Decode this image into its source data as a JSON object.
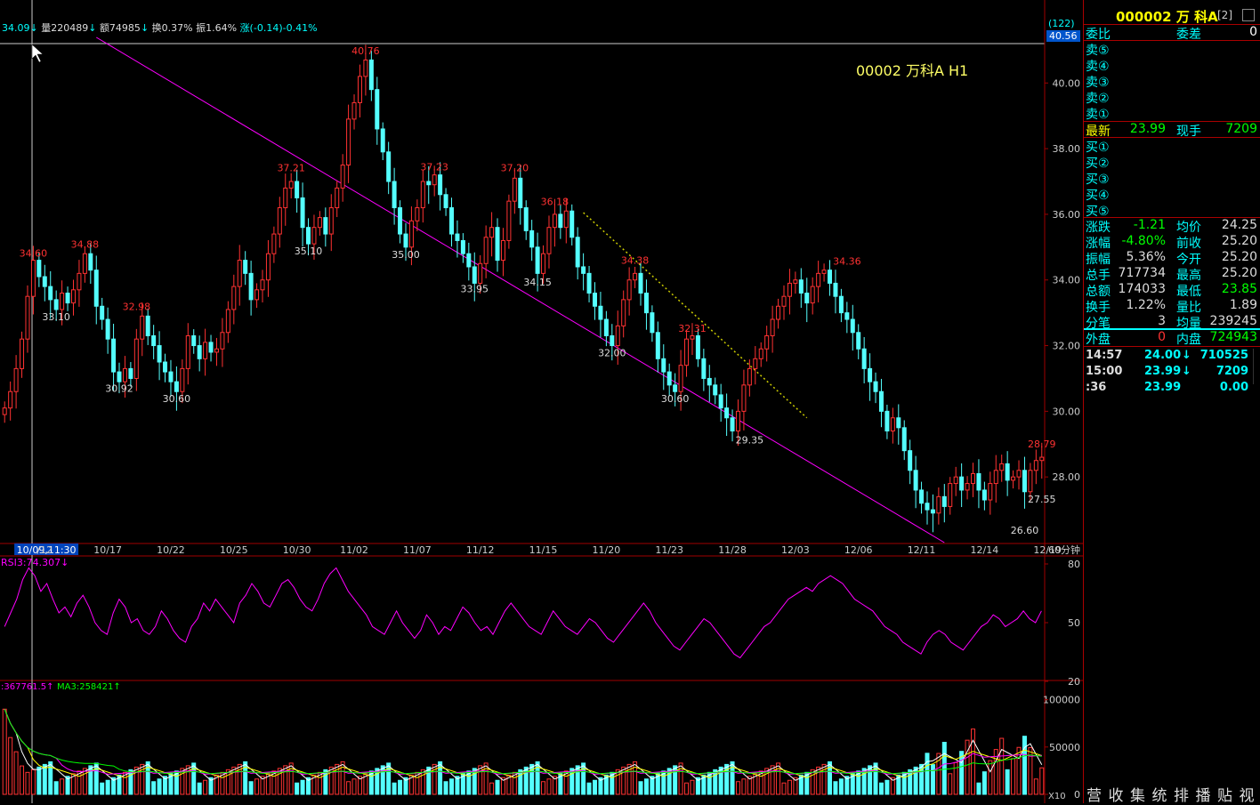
{
  "header": {
    "price_line": "34.09",
    "vol": "量220489",
    "amount": "额74985",
    "turnover": "换0.37%",
    "amplitude": "振1.64%",
    "change": "涨(-0.14)-0.41%",
    "cursor_count": "(122)",
    "cursor_price": "40.56",
    "stock_title": "00002 万科A H1"
  },
  "side": {
    "title": "000002 万 科A",
    "title_tag": "[2]",
    "weibi_label": "委比",
    "weicha_label": "委差",
    "weicha_value": "0",
    "sell_labels": [
      "卖⑤",
      "卖④",
      "卖③",
      "卖②",
      "卖①"
    ],
    "buy_labels": [
      "买①",
      "买②",
      "买③",
      "买④",
      "买⑤"
    ],
    "latest_label": "最新",
    "latest_value": "23.99",
    "xianshou_label": "现手",
    "xianshou_value": "7209",
    "stats": [
      {
        "l1": "涨跌",
        "v1": "-1.21",
        "l2": "均价",
        "v2": "24.25"
      },
      {
        "l1": "涨幅",
        "v1": "-4.80%",
        "l2": "前收",
        "v2": "25.20"
      },
      {
        "l1": "振幅",
        "v1": "5.36%",
        "l2": "今开",
        "v2": "25.20"
      },
      {
        "l1": "总手",
        "v1": "717734",
        "l2": "最高",
        "v2": "25.20"
      },
      {
        "l1": "总额",
        "v1": "174033",
        "l2": "最低",
        "v2": "23.85"
      },
      {
        "l1": "换手",
        "v1": "1.22%",
        "l2": "量比",
        "v2": "1.89"
      },
      {
        "l1": "分笔",
        "v1": "3",
        "l2": "均量",
        "v2": "239245"
      }
    ],
    "waipan_label": "外盘",
    "waipan_value": "0",
    "neipan_label": "内盘",
    "neipan_value": "724943",
    "ticks": [
      {
        "t": "14:57",
        "p": "24.00",
        "a": "↓",
        "v": "710525"
      },
      {
        "t": "15:00",
        "p": "23.99",
        "a": "↓",
        "v": "7209"
      },
      {
        "t": ":36",
        "p": "23.99",
        "a": "",
        "v": "0.00"
      }
    ],
    "bottom_buttons": [
      "营",
      "收",
      "集",
      "统",
      "排",
      "播",
      "贴",
      "视"
    ]
  },
  "colors": {
    "up": "#ff3232",
    "down": "#54ffff",
    "fall": "#00ff00",
    "ma5": "#ffffff",
    "ma10": "#ffff00",
    "ma20": "#ff00ff",
    "ma30": "#00ff00",
    "trend": "#ff00ff",
    "dotted": "#cccc00",
    "grid": "#a00000"
  },
  "chart_data": {
    "type": "candlestick",
    "period_label": "60分钟",
    "yticks": [
      "40.00",
      "38.00",
      "36.00",
      "34.00",
      "32.00",
      "30.00",
      "28.00"
    ],
    "xlabels": [
      {
        "i": 2,
        "t": "10/09,11:30"
      },
      {
        "i": 7,
        "t": "/12"
      },
      {
        "i": 18,
        "t": "10/17"
      },
      {
        "i": 29,
        "t": "10/22"
      },
      {
        "i": 40,
        "t": "10/25"
      },
      {
        "i": 51,
        "t": "10/30"
      },
      {
        "i": 61,
        "t": "11/02"
      },
      {
        "i": 72,
        "t": "11/07"
      },
      {
        "i": 83,
        "t": "11/12"
      },
      {
        "i": 94,
        "t": "11/15"
      },
      {
        "i": 105,
        "t": "11/20"
      },
      {
        "i": 116,
        "t": "11/23"
      },
      {
        "i": 127,
        "t": "11/28"
      },
      {
        "i": 138,
        "t": "12/03"
      },
      {
        "i": 149,
        "t": "12/06"
      },
      {
        "i": 160,
        "t": "12/11"
      },
      {
        "i": 171,
        "t": "12/14"
      },
      {
        "i": 182,
        "t": "12/19"
      }
    ],
    "close": [
      30.1,
      30.6,
      31.3,
      32.2,
      33.5,
      34.6,
      34.1,
      33.8,
      33.4,
      33.1,
      33.6,
      33.3,
      33.7,
      34.2,
      34.8,
      34.3,
      33.2,
      32.8,
      32.2,
      31.2,
      30.9,
      31.3,
      31.0,
      32.2,
      32.9,
      32.3,
      32.0,
      31.5,
      31.2,
      30.9,
      30.6,
      31.3,
      32.3,
      32.0,
      31.6,
      32.1,
      31.8,
      31.9,
      32.4,
      33.1,
      33.8,
      34.6,
      34.2,
      33.4,
      33.7,
      34.0,
      34.8,
      35.4,
      36.2,
      36.8,
      37.0,
      36.5,
      35.6,
      35.1,
      35.6,
      35.9,
      35.4,
      36.2,
      36.8,
      37.5,
      38.9,
      39.4,
      40.2,
      40.7,
      39.8,
      38.6,
      37.9,
      37.0,
      36.2,
      35.4,
      35.0,
      35.8,
      36.2,
      37.0,
      36.9,
      37.2,
      36.6,
      36.2,
      35.4,
      35.2,
      34.8,
      34.4,
      33.9,
      34.5,
      35.3,
      35.6,
      34.6,
      35.2,
      36.4,
      37.1,
      36.2,
      35.5,
      35.0,
      34.2,
      34.8,
      35.6,
      36.0,
      35.6,
      36.1,
      35.3,
      34.4,
      34.2,
      33.6,
      33.2,
      32.8,
      32.3,
      32.0,
      32.6,
      33.4,
      34.0,
      34.2,
      33.6,
      33.0,
      32.4,
      31.6,
      31.2,
      30.8,
      30.6,
      31.4,
      32.2,
      32.3,
      31.6,
      31.0,
      30.8,
      30.5,
      30.1,
      29.8,
      29.4,
      30.0,
      30.8,
      31.3,
      31.6,
      31.9,
      32.3,
      32.8,
      33.2,
      33.5,
      33.9,
      34.0,
      33.6,
      33.3,
      33.8,
      34.2,
      34.3,
      33.9,
      33.5,
      33.0,
      32.8,
      32.4,
      31.9,
      31.3,
      30.9,
      30.6,
      30.0,
      29.4,
      29.8,
      29.5,
      28.8,
      28.2,
      27.6,
      27.2,
      27.0,
      26.9,
      27.4,
      27.1,
      27.8,
      28.0,
      27.6,
      27.8,
      28.1,
      27.6,
      27.3,
      27.8,
      28.2,
      28.4,
      27.9,
      28.0,
      28.2,
      27.55,
      28.2,
      28.5,
      28.6
    ]
  },
  "rsi": {
    "label": "RSI3:74.307↓",
    "ticks": [
      "80",
      "50",
      "20"
    ],
    "values": [
      48,
      55,
      62,
      72,
      78,
      74,
      66,
      70,
      62,
      55,
      58,
      53,
      60,
      64,
      58,
      50,
      46,
      44,
      55,
      62,
      58,
      50,
      52,
      46,
      44,
      48,
      56,
      52,
      46,
      42,
      40,
      48,
      52,
      60,
      56,
      62,
      58,
      54,
      50,
      60,
      64,
      70,
      66,
      60,
      58,
      64,
      70,
      72,
      68,
      62,
      58,
      56,
      62,
      70,
      75,
      78,
      72,
      66,
      62,
      58,
      54,
      48,
      46,
      44,
      50,
      56,
      50,
      46,
      42,
      46,
      54,
      50,
      44,
      48,
      46,
      52,
      58,
      55,
      50,
      46,
      48,
      44,
      50,
      56,
      60,
      56,
      52,
      48,
      46,
      44,
      50,
      56,
      52,
      48,
      46,
      44,
      48,
      52,
      50,
      46,
      42,
      40,
      44,
      48,
      52,
      56,
      60,
      56,
      50,
      46,
      42,
      38,
      36,
      40,
      44,
      48,
      52,
      50,
      46,
      42,
      38,
      34,
      32,
      36,
      40,
      44,
      48,
      50,
      54,
      58,
      62,
      64,
      66,
      68,
      66,
      70,
      72,
      74,
      72,
      70,
      66,
      62,
      60,
      58,
      56,
      52,
      48,
      46,
      44,
      40,
      38,
      36,
      34,
      40,
      44,
      46,
      44,
      40,
      38,
      36,
      40,
      44,
      48,
      50,
      54,
      52,
      48,
      50,
      52,
      56,
      52,
      50,
      56
    ],
    "level_lines": [
      80,
      50,
      20
    ]
  },
  "volume": {
    "label": ":367761.5↑",
    "ma_label": "MA3:258421↑",
    "ticks": [
      "100000",
      "50000",
      "0"
    ],
    "scale_label": "X10",
    "max": 110000
  }
}
